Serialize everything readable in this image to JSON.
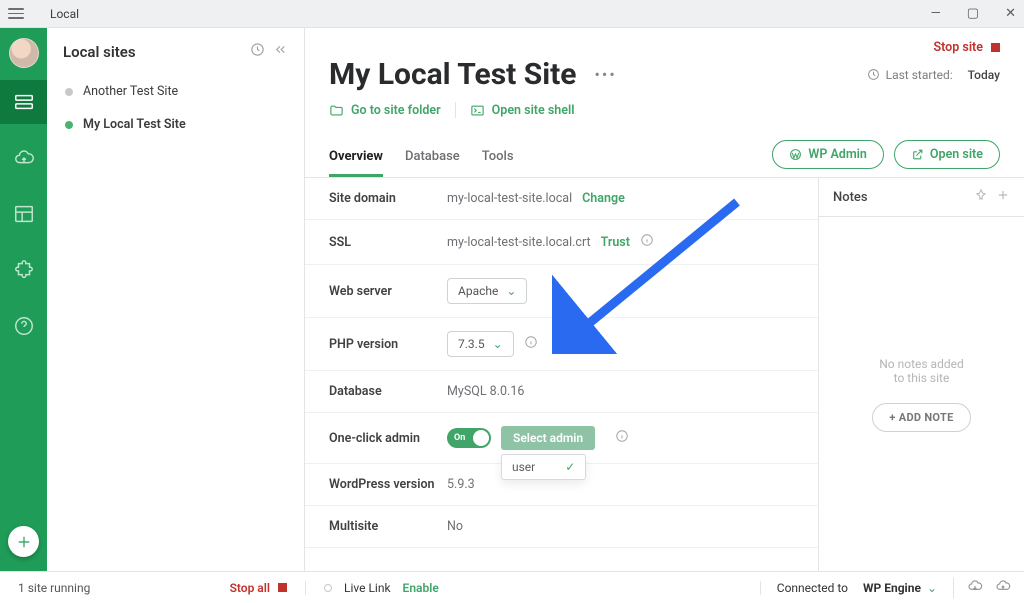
{
  "app": {
    "name": "Local"
  },
  "window_controls": {
    "minimize": "—",
    "maximize": "▢",
    "close": "✕"
  },
  "sidebar": {
    "title": "Local sites",
    "items": [
      {
        "label": "Another Test Site",
        "active": false
      },
      {
        "label": "My Local Test Site",
        "active": true
      }
    ]
  },
  "stop_site_label": "Stop site",
  "site": {
    "title": "My Local Test Site",
    "last_started_label": "Last started:",
    "last_started_value": "Today",
    "go_to_folder": "Go to site folder",
    "open_shell": "Open site shell"
  },
  "tabs": [
    "Overview",
    "Database",
    "Tools"
  ],
  "tab_active": "Overview",
  "actions": {
    "wp_admin": "WP Admin",
    "open_site": "Open site"
  },
  "overview": {
    "site_domain_label": "Site domain",
    "site_domain": "my-local-test-site.local",
    "change": "Change",
    "ssl_label": "SSL",
    "ssl_value": "my-local-test-site.local.crt",
    "trust": "Trust",
    "web_server_label": "Web server",
    "web_server": "Apache",
    "php_label": "PHP version",
    "php": "7.3.5",
    "db_label": "Database",
    "db": "MySQL 8.0.16",
    "oneclick_label": "One-click admin",
    "oneclick_toggle": "On",
    "select_admin": "Select admin",
    "admin_dropdown_option": "user",
    "wp_label": "WordPress version",
    "wp": "5.9.3",
    "multi_label": "Multisite",
    "multi": "No"
  },
  "notes": {
    "title": "Notes",
    "empty1": "No notes added",
    "empty2": "to this site",
    "add": "+ ADD NOTE"
  },
  "footer": {
    "running": "1 site running",
    "stop_all": "Stop all",
    "live_link": "Live Link",
    "enable": "Enable",
    "connected_to": "Connected to",
    "provider": "WP Engine"
  }
}
